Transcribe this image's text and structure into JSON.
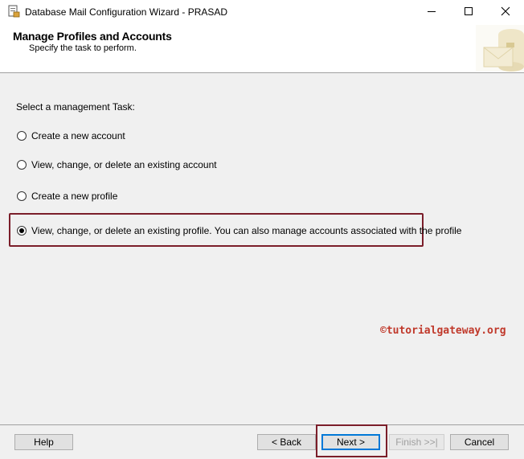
{
  "window": {
    "title": "Database Mail Configuration Wizard - PRASAD"
  },
  "title_controls": {
    "minimize_icon": "minimize-icon",
    "maximize_icon": "maximize-icon",
    "close_icon": "close-icon"
  },
  "header": {
    "title": "Manage Profiles and Accounts",
    "subtitle": "Specify the task to perform."
  },
  "main": {
    "prompt": "Select a management Task:",
    "options": [
      {
        "label": "Create a new account",
        "selected": false
      },
      {
        "label": "View, change, or delete an existing account",
        "selected": false
      },
      {
        "label": "Create a new profile",
        "selected": false
      },
      {
        "label": "View, change, or delete an existing profile. You can also manage accounts associated with the profile",
        "selected": true
      }
    ],
    "watermark": "©tutorialgateway.org"
  },
  "footer": {
    "help_label": "Help",
    "back_label": "< Back",
    "next_label": "Next >",
    "finish_label": "Finish >>|",
    "cancel_label": "Cancel"
  },
  "colors": {
    "highlight_border": "#7b1e2a",
    "watermark": "#c0392b",
    "focus_blue": "#0078d7"
  }
}
